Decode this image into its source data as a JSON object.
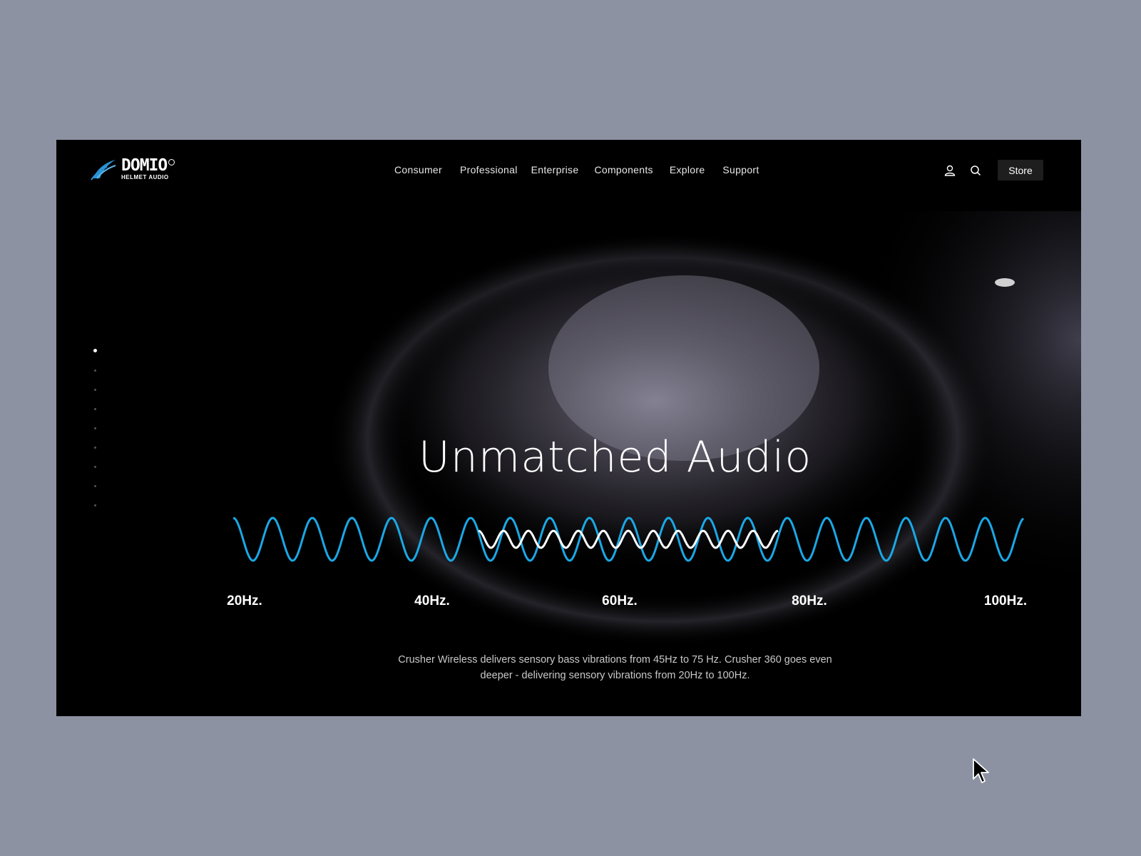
{
  "brand": {
    "name": "DOMIO",
    "tagline": "HELMET AUDIO",
    "logo_icon": "wing-logo-icon",
    "accent_color": "#2a93d5"
  },
  "nav": {
    "items": [
      {
        "label": "Consumer"
      },
      {
        "label": "Professional"
      },
      {
        "label": "Enterprise"
      },
      {
        "label": "Components"
      },
      {
        "label": "Explore"
      },
      {
        "label": "Support"
      }
    ]
  },
  "header_actions": {
    "account_icon": "user-icon",
    "search_icon": "search-icon",
    "store_label": "Store"
  },
  "pager": {
    "total": 9,
    "active_index": 0
  },
  "hero": {
    "title": "Unmatched Audio",
    "wave_colors": {
      "outer": "#1aa8e6",
      "inner": "#ffffff"
    },
    "frequency_labels": [
      "20Hz.",
      "40Hz.",
      "60Hz.",
      "80Hz.",
      "100Hz."
    ],
    "description_line1": "Crusher Wireless delivers sensory bass vibrations from 45Hz to 75 Hz. Crusher 360 goes even",
    "description_line2": "deeper - delivering sensory vibrations from 20Hz to 100Hz."
  }
}
